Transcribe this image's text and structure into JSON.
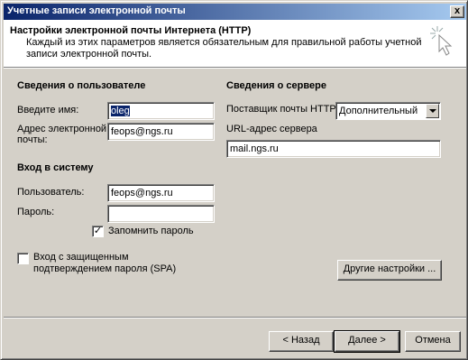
{
  "window": {
    "title": "Учетные записи электронной почты",
    "close_glyph": "x"
  },
  "header": {
    "title": "Настройки электронной почты Интернета (HTTP)",
    "subtitle": "Каждый из этих параметров является обязательным для правильной работы учетной записи электронной почты.",
    "icon": "wizard-sparkle-cursor-icon"
  },
  "user_info": {
    "heading": "Сведения о пользователе",
    "name_label": "Введите имя:",
    "name_value": "oleg",
    "email_label_line1": "Адрес электронной",
    "email_label_line2": "почты:",
    "email_value": "feops@ngs.ru"
  },
  "logon": {
    "heading": "Вход в систему",
    "user_label": "Пользователь:",
    "user_value": "feops@ngs.ru",
    "password_label": "Пароль:",
    "password_value": "",
    "remember_label": "Запомнить пароль",
    "remember_checked": true,
    "spa_label_line1": "Вход с защищенным",
    "spa_label_line2": "подтверждением пароля (SPA)",
    "spa_checked": false
  },
  "server_info": {
    "heading": "Сведения о сервере",
    "provider_label": "Поставщик почты HTTP:",
    "provider_value": "Дополнительный",
    "url_label": "URL-адрес сервера",
    "url_value": "mail.ngs.ru",
    "more_settings_label": "Другие настройки ..."
  },
  "footer": {
    "back_label": "< Назад",
    "next_label": "Далее >",
    "cancel_label": "Отмена"
  }
}
